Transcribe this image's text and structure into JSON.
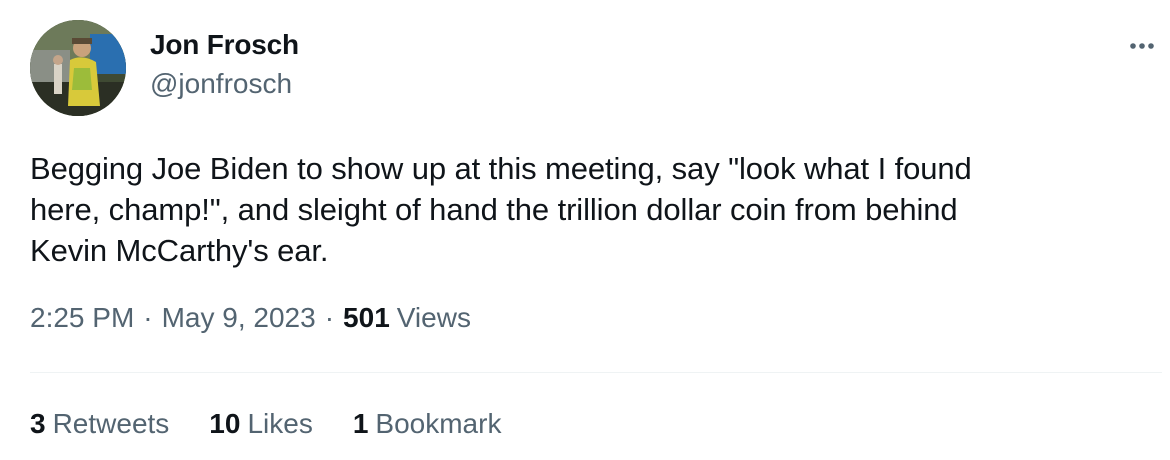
{
  "author": {
    "display_name": "Jon Frosch",
    "handle": "@jonfrosch"
  },
  "tweet": {
    "text": "Begging Joe Biden to show up at this meeting, say \"look what I found\nhere, champ!\", and sleight of hand the trillion dollar coin from behind\nKevin McCarthy's ear."
  },
  "meta": {
    "time": "2:25 PM",
    "separator": "·",
    "date": "May 9, 2023",
    "views_count": "501",
    "views_label": "Views"
  },
  "stats": {
    "retweets_count": "3",
    "retweets_label": "Retweets",
    "likes_count": "10",
    "likes_label": "Likes",
    "bookmarks_count": "1",
    "bookmarks_label": "Bookmark"
  },
  "icons": {
    "more": "more-horizontal-icon"
  },
  "colors": {
    "text_primary": "#0f1419",
    "text_secondary": "#536471",
    "divider": "#eff3f4"
  }
}
